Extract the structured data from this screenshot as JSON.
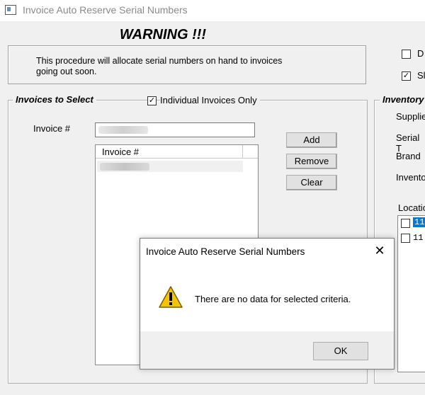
{
  "window": {
    "title": "Invoice Auto Reserve Serial Numbers"
  },
  "warning": {
    "heading": "WARNING !!!",
    "line1": "This procedure will allocate serial numbers on hand to invoices",
    "line2": "going out soon."
  },
  "right_options": {
    "opt1_label": "D",
    "opt2_label": "Sl",
    "opt1_checked": false,
    "opt2_checked": true
  },
  "invoices_group": {
    "title": "Invoices to Select",
    "individual_only_label": "Individual Invoices Only",
    "individual_only_checked": true,
    "invoice_label": "Invoice #",
    "list_header": "Invoice #",
    "buttons": {
      "add": "Add",
      "remove": "Remove",
      "clear": "Clear"
    }
  },
  "inventory_group": {
    "title": "Inventory",
    "supplier_label": "Supplie",
    "serial_type_label": "Serial T",
    "brand_label": "Brand",
    "inventory_label": "Invento",
    "location_label": "Locatio",
    "locations": [
      "11",
      "11"
    ]
  },
  "dialog": {
    "title": "Invoice Auto Reserve Serial Numbers",
    "message": "There are no data for selected criteria.",
    "ok_label": "OK",
    "close_glyph": "✕"
  },
  "colors": {
    "selection": "#0078d7",
    "warning_icon": "#f5c400"
  }
}
